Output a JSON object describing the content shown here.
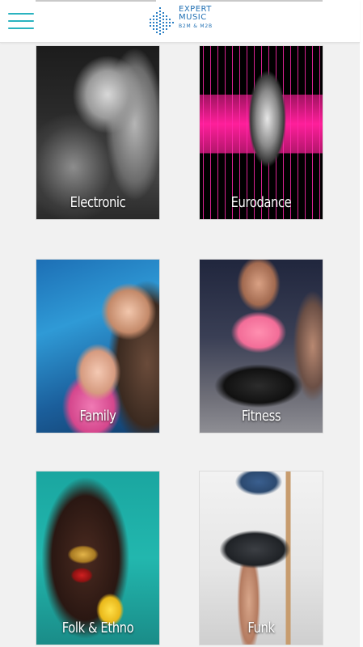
{
  "header": {
    "menu_icon": "hamburger-menu-icon",
    "logo": {
      "line1": "EXPERT",
      "line2": "MUSIC",
      "tagline": "B2M & M2B",
      "color": "#1f6fb3"
    },
    "accent_color": "#2bb3c0"
  },
  "genres": [
    {
      "label": "Electronic"
    },
    {
      "label": "Eurodance"
    },
    {
      "label": "Family"
    },
    {
      "label": "Fitness"
    },
    {
      "label": "Folk & Ethno"
    },
    {
      "label": "Funk"
    }
  ]
}
